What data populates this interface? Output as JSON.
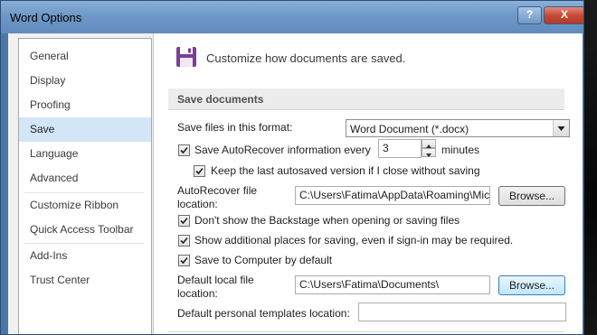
{
  "window": {
    "title": "Word Options",
    "help_label": "?",
    "close_label": "X"
  },
  "sidebar": {
    "items": [
      {
        "label": "General"
      },
      {
        "label": "Display"
      },
      {
        "label": "Proofing"
      },
      {
        "label": "Save",
        "selected": true
      },
      {
        "label": "Language"
      },
      {
        "label": "Advanced"
      },
      {
        "label": "Customize Ribbon"
      },
      {
        "label": "Quick Access Toolbar"
      },
      {
        "label": "Add-Ins"
      },
      {
        "label": "Trust Center"
      }
    ]
  },
  "header": {
    "icon": "floppy-disk-icon",
    "text": "Customize how documents are saved.",
    "accent": "#7b3f98"
  },
  "save_section": {
    "title": "Save documents",
    "format_label": "Save files in this format:",
    "format_value": "Word Document (*.docx)",
    "autorecover_label": "Save AutoRecover information every",
    "autorecover_checked": true,
    "autorecover_minutes": "3",
    "minutes_label": "minutes",
    "keep_last_label": "Keep the last autosaved version if I close without saving",
    "keep_last_checked": true,
    "autorecover_location_label_1": "AutoRecover file",
    "autorecover_location_label_2": "location:",
    "autorecover_location_value": "C:\\Users\\Fatima\\AppData\\Roaming\\Mic",
    "browse_label": "Browse...",
    "backstage_label": "Don't show the Backstage when opening or saving files",
    "backstage_checked": true,
    "additional_places_label": "Show additional places for saving, even if sign-in may be required.",
    "additional_places_checked": true,
    "save_computer_label": "Save to Computer by default",
    "save_computer_checked": true,
    "default_local_label_1": "Default local file",
    "default_local_label_2": "location:",
    "default_local_value": "C:\\Users\\Fatima\\Documents\\",
    "browse2_label": "Browse...",
    "templates_label": "Default personal templates location:",
    "templates_value": ""
  }
}
